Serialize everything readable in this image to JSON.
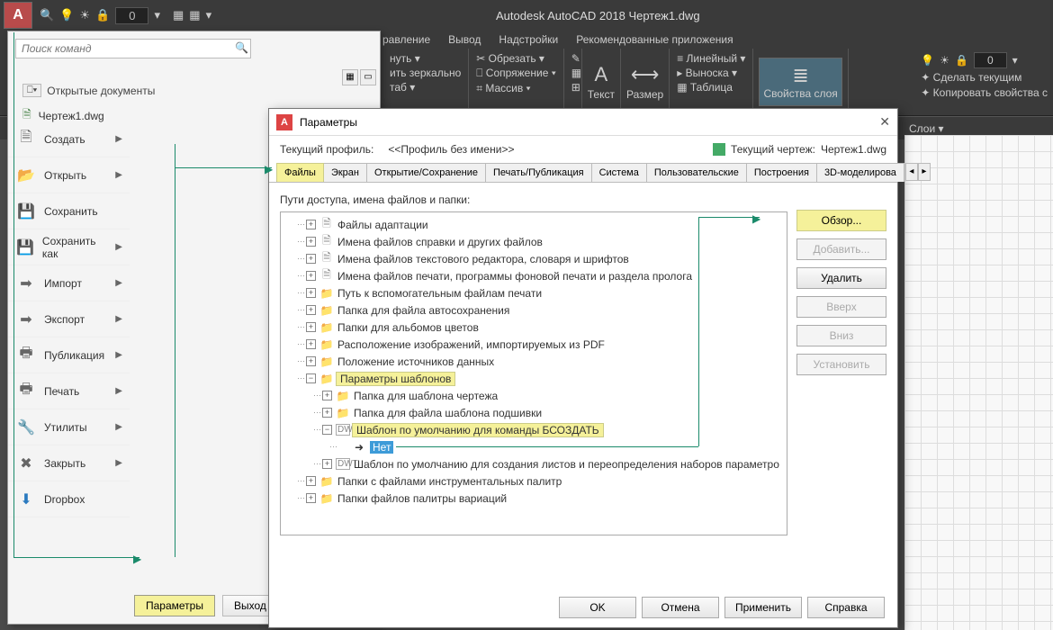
{
  "titlebar": {
    "logo": "A",
    "qat_layer": "0",
    "title": "Autodesk AutoCAD 2018   Чертеж1.dwg"
  },
  "ribbon_tabs": [
    "равление",
    "Вывод",
    "Надстройки",
    "Рекомендованные приложения"
  ],
  "ribbon": {
    "p1": {
      "a": "нуть ▾",
      "b": "ить зеркально",
      "c": "таб ▾"
    },
    "p2": {
      "a": "✂ Обрезать ▾",
      "b": "⎕ Сопряжение ▾",
      "c": "⌗ Массив ▾"
    },
    "text": "Текст",
    "dim": "Размер",
    "p3": {
      "a": "≡ Линейный ▾",
      "b": "▸ Выноска ▾",
      "c": "▦ Таблица"
    },
    "props": "Свойства слоя"
  },
  "right_ribbon": {
    "layer_combo": "0",
    "a": "✦ Сделать текущим",
    "b": "✦ Копировать свойства с"
  },
  "layers_bar": {
    "label": "Слои ▾"
  },
  "app_menu": {
    "search_placeholder": "Поиск команд",
    "recent_header": "Открытые документы",
    "recent_item": "Чертеж1.dwg",
    "items": [
      {
        "icon": "🗎",
        "label": "Создать"
      },
      {
        "icon": "📂",
        "label": "Открыть"
      },
      {
        "icon": "💾",
        "label": "Сохранить"
      },
      {
        "icon": "💾",
        "label": "Сохранить как"
      },
      {
        "icon": "➡",
        "label": "Импорт"
      },
      {
        "icon": "➡",
        "label": "Экспорт"
      },
      {
        "icon": "🖶",
        "label": "Публикация"
      },
      {
        "icon": "🖶",
        "label": "Печать"
      },
      {
        "icon": "🔧",
        "label": "Утилиты"
      },
      {
        "icon": "✖",
        "label": "Закрыть"
      },
      {
        "icon": "⬇",
        "label": "Dropbox"
      }
    ],
    "params_btn": "Параметры",
    "exit_btn": "Выход и"
  },
  "dialog": {
    "title": "Параметры",
    "profile_lbl": "Текущий профиль:",
    "profile_val": "<<Профиль без имени>>",
    "drawing_lbl": "Текущий чертеж:",
    "drawing_val": "Чертеж1.dwg",
    "tabs": [
      "Файлы",
      "Экран",
      "Открытие/Сохранение",
      "Печать/Публикация",
      "Система",
      "Пользовательские",
      "Построения",
      "3D-моделирова"
    ],
    "paths_label": "Пути доступа, имена файлов и папки:",
    "tree": [
      {
        "lvl": 1,
        "pm": "+",
        "kind": "doc",
        "text": "Файлы адаптации"
      },
      {
        "lvl": 1,
        "pm": "+",
        "kind": "doc",
        "text": "Имена файлов справки и других файлов"
      },
      {
        "lvl": 1,
        "pm": "+",
        "kind": "doc",
        "text": "Имена файлов текстового редактора, словаря и шрифтов"
      },
      {
        "lvl": 1,
        "pm": "+",
        "kind": "doc",
        "text": "Имена файлов печати, программы фоновой печати и раздела пролога"
      },
      {
        "lvl": 1,
        "pm": "+",
        "kind": "fold",
        "text": "Путь к вспомогательным файлам печати"
      },
      {
        "lvl": 1,
        "pm": "+",
        "kind": "fold",
        "text": "Папка для файла автосохранения"
      },
      {
        "lvl": 1,
        "pm": "+",
        "kind": "fold",
        "text": "Папки для альбомов цветов"
      },
      {
        "lvl": 1,
        "pm": "+",
        "kind": "fold",
        "text": "Расположение изображений, импортируемых из PDF"
      },
      {
        "lvl": 1,
        "pm": "+",
        "kind": "fold",
        "text": "Положение источников данных"
      },
      {
        "lvl": 1,
        "pm": "−",
        "kind": "fold",
        "text": "Параметры шаблонов",
        "hl": true
      },
      {
        "lvl": 2,
        "pm": "+",
        "kind": "fold",
        "text": "Папка для шаблона чертежа"
      },
      {
        "lvl": 2,
        "pm": "+",
        "kind": "fold",
        "text": "Папка для файла шаблона подшивки"
      },
      {
        "lvl": 2,
        "pm": "−",
        "kind": "dwg",
        "text": "Шаблон по умолчанию для команды БСОЗДАТЬ",
        "hl": true
      },
      {
        "lvl": 3,
        "pm": "",
        "kind": "arr",
        "text": "Нет",
        "sel": true
      },
      {
        "lvl": 2,
        "pm": "+",
        "kind": "dwg",
        "text": "Шаблон по умолчанию для создания листов и переопределения наборов параметро"
      },
      {
        "lvl": 1,
        "pm": "+",
        "kind": "fold",
        "text": "Папки с файлами инструментальных палитр"
      },
      {
        "lvl": 1,
        "pm": "+",
        "kind": "fold",
        "text": "Папки файлов палитры вариаций"
      }
    ],
    "buttons": {
      "browse": "Обзор...",
      "add": "Добавить...",
      "delete": "Удалить",
      "up": "Вверх",
      "down": "Вниз",
      "set": "Установить"
    },
    "footer": {
      "ok": "OK",
      "cancel": "Отмена",
      "apply": "Применить",
      "help": "Справка"
    }
  }
}
